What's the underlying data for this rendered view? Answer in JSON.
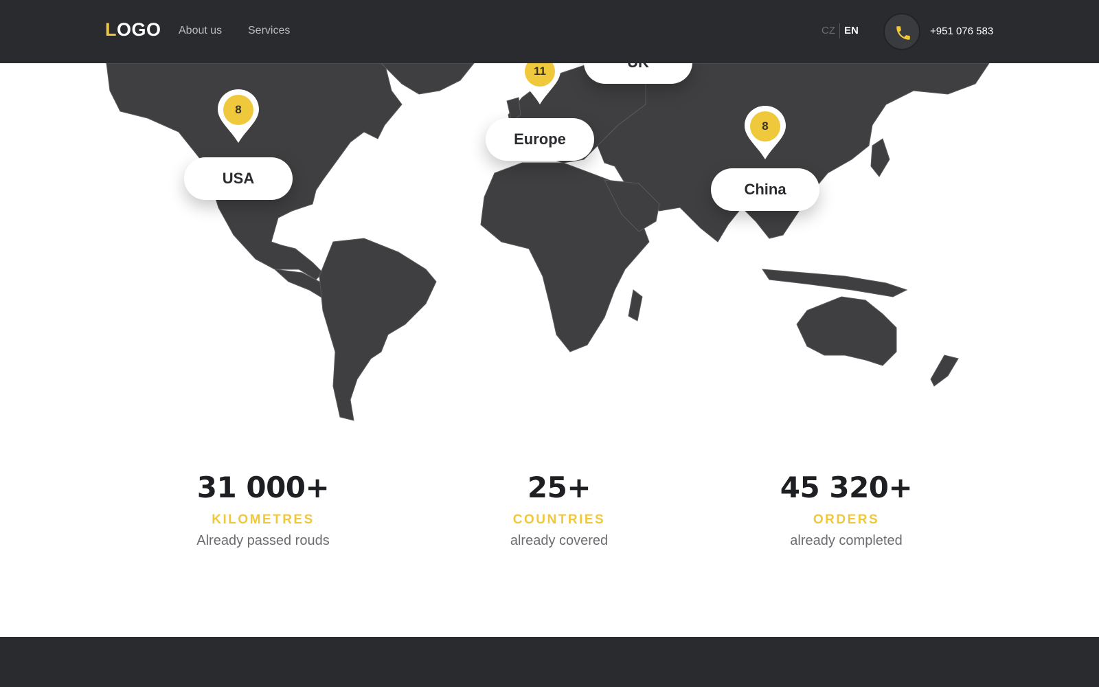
{
  "header": {
    "logo_lead": "L",
    "logo_rest": "OGO",
    "nav": [
      "About us",
      "Services"
    ],
    "languages": {
      "inactive": "CZ",
      "active": "EN"
    },
    "phone": "+951 076 583",
    "phone_icon": "phone-icon"
  },
  "map": {
    "regions": [
      {
        "label": "USA",
        "count": "8"
      },
      {
        "label": "Europe",
        "count": "11"
      },
      {
        "label": "UK"
      },
      {
        "label": "China",
        "count": "8"
      }
    ]
  },
  "stats": [
    {
      "value": "31 000+",
      "unit": "KILOMETRES",
      "desc": "Already passed rouds"
    },
    {
      "value": "25+",
      "unit": "COUNTRIES",
      "desc": "already covered"
    },
    {
      "value": "45 320+",
      "unit": "ORDERS",
      "desc": "already completed"
    }
  ],
  "colors": {
    "accent": "#f0c83c",
    "dark": "#2a2b2e",
    "land": "#3f3f41"
  }
}
